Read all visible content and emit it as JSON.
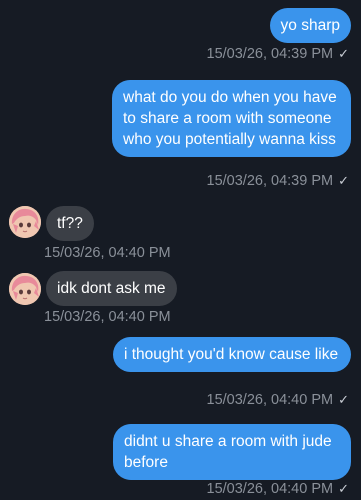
{
  "messages": [
    {
      "direction": "outgoing",
      "text": "yo sharp",
      "timestamp": "15/03/26, 04:39 PM",
      "read_icon": "checkmark-icon"
    },
    {
      "direction": "outgoing",
      "text": "what do you do when you have to share a room with someone who you potentially wanna kiss",
      "timestamp": "15/03/26, 04:39 PM",
      "read_icon": "checkmark-icon"
    },
    {
      "direction": "incoming",
      "text": "tf??",
      "timestamp": "15/03/26, 04:40 PM"
    },
    {
      "direction": "incoming",
      "text": "idk dont ask me",
      "timestamp": "15/03/26, 04:40 PM"
    },
    {
      "direction": "outgoing",
      "text": "i thought you'd know cause like",
      "timestamp": "15/03/26, 04:40 PM",
      "read_icon": "checkmark-icon"
    },
    {
      "direction": "outgoing",
      "text": "didnt u share a room with jude before",
      "timestamp": "15/03/26, 04:40 PM",
      "read_icon": "checkmark-icon"
    }
  ],
  "check_glyph": "✓",
  "colors": {
    "background": "#161b24",
    "outgoing_bubble": "#3a94ec",
    "incoming_bubble": "#3b3f46",
    "timestamp": "#8a9099"
  }
}
